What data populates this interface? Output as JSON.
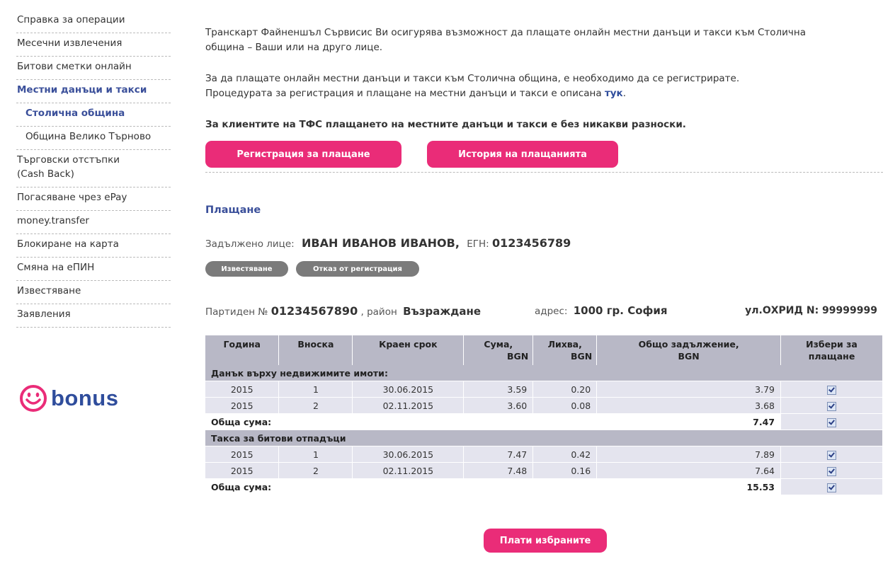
{
  "sidebar": {
    "items": [
      "Справка за операции",
      "Месечни извлечения",
      "Битови сметки онлайн",
      "Местни данъци и такси",
      "Столична община",
      "Община Велико Търново",
      "Търговски отстъпки",
      "(Cash Back)",
      "Погасяване чрез ePay",
      "money.transfer",
      "Блокиране на карта",
      "Смяна на еПИН",
      "Известяване",
      "Заявления"
    ],
    "bonus": "bonus"
  },
  "intro": {
    "p1_line1": "Транскарт Файненшъл Сървисис Ви осигурява възможност да плащате онлайн местни данъци и такси към Столична",
    "p1_line2": "община – Ваши или на друго лице.",
    "p2_line1": "За да плащате онлайн местни данъци и такси към Столична община, е необходимо да се регистрирате.",
    "p2_line2": "Процедурата за регистрация и плащане на местни данъци и такси е описана",
    "p2_link": "тук",
    "p3": "За клиентите на ТФС плащането на местните данъци и такси е без никакви разноски."
  },
  "buttons": {
    "register": "Регистрация за плащане",
    "history": "История на плащанията",
    "notify": "Известяване",
    "unregister": "Отказ от регистрация",
    "pay": "Плати избраните"
  },
  "payment": {
    "heading": "Плащане",
    "obligor_label": "Задължено лице:",
    "obligor_name": "ИВАН ИВАНОВ ИВАНОВ,",
    "egn_label": "ЕГН:",
    "egn": "0123456789",
    "party_label": "Партиден №",
    "party_no": "01234567890",
    "district_label": ", район",
    "district": "Възраждане",
    "address_label": "адрес:",
    "address": "1000  гр. София",
    "street": "ул.ОХРИД N: 99999999"
  },
  "table": {
    "headers": {
      "year": "Година",
      "installment": "Вноска",
      "deadline": "Краен срок",
      "sum": "Сума,",
      "sum_unit": "BGN",
      "interest": "Лихва,",
      "interest_unit": "BGN",
      "total": "Общо задължение,",
      "total_unit": "BGN",
      "select": "Избери за",
      "select2": "плащане"
    },
    "group1": {
      "title": "Данък върху недвижимите имоти:",
      "rows": [
        {
          "year": "2015",
          "inst": "1",
          "deadline": "30.06.2015",
          "sum": "3.59",
          "interest": "0.20",
          "total": "3.79"
        },
        {
          "year": "2015",
          "inst": "2",
          "deadline": "02.11.2015",
          "sum": "3.60",
          "interest": "0.08",
          "total": "3.68"
        }
      ],
      "total_label": "Обща сума:",
      "total_value": "7.47"
    },
    "group2": {
      "title": "Такса за битови отпадъци",
      "rows": [
        {
          "year": "2015",
          "inst": "1",
          "deadline": "30.06.2015",
          "sum": "7.47",
          "interest": "0.42",
          "total": "7.89"
        },
        {
          "year": "2015",
          "inst": "2",
          "deadline": "02.11.2015",
          "sum": "7.48",
          "interest": "0.16",
          "total": "7.64"
        }
      ],
      "total_label": "Обща сума:",
      "total_value": "15.53"
    }
  },
  "colors": {
    "accent": "#ea2c78",
    "link": "#2f4d9c",
    "table_header": "#b8b8c6",
    "table_row": "#e4e4ee"
  }
}
